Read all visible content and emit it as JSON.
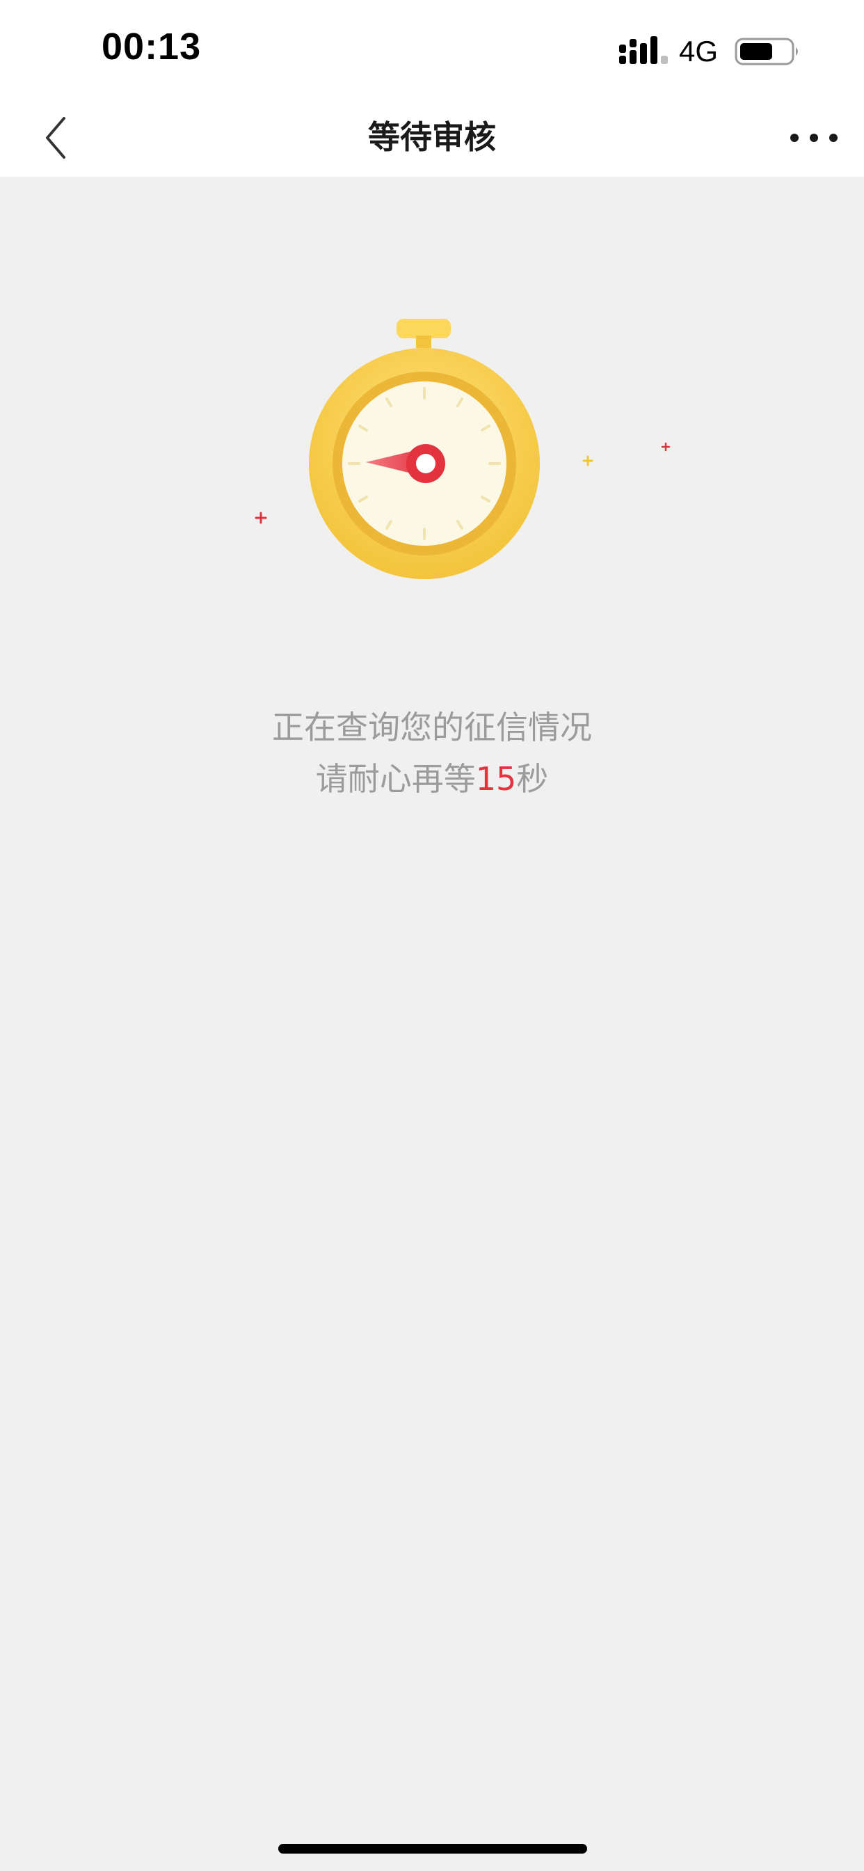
{
  "status_bar": {
    "time": "00:13",
    "network": "4G",
    "signal_icon": "cellular-signal-icon",
    "battery_icon": "battery-icon"
  },
  "nav": {
    "title": "等待审核",
    "back_icon": "chevron-left-icon",
    "more_icon": "more-horizontal-icon"
  },
  "illustration": {
    "icon": "stopwatch-icon",
    "colors": {
      "body": "#f5c842",
      "face": "#fbf8e6",
      "hand": "#e2333f"
    }
  },
  "message": {
    "line1": "正在查询您的征信情况",
    "line2_prefix": "请耐心再等",
    "countdown": "15",
    "line2_suffix": "秒"
  },
  "colors": {
    "background": "#f0f0f1",
    "text_secondary": "#9b9b9b",
    "accent_red": "#e2333f"
  }
}
